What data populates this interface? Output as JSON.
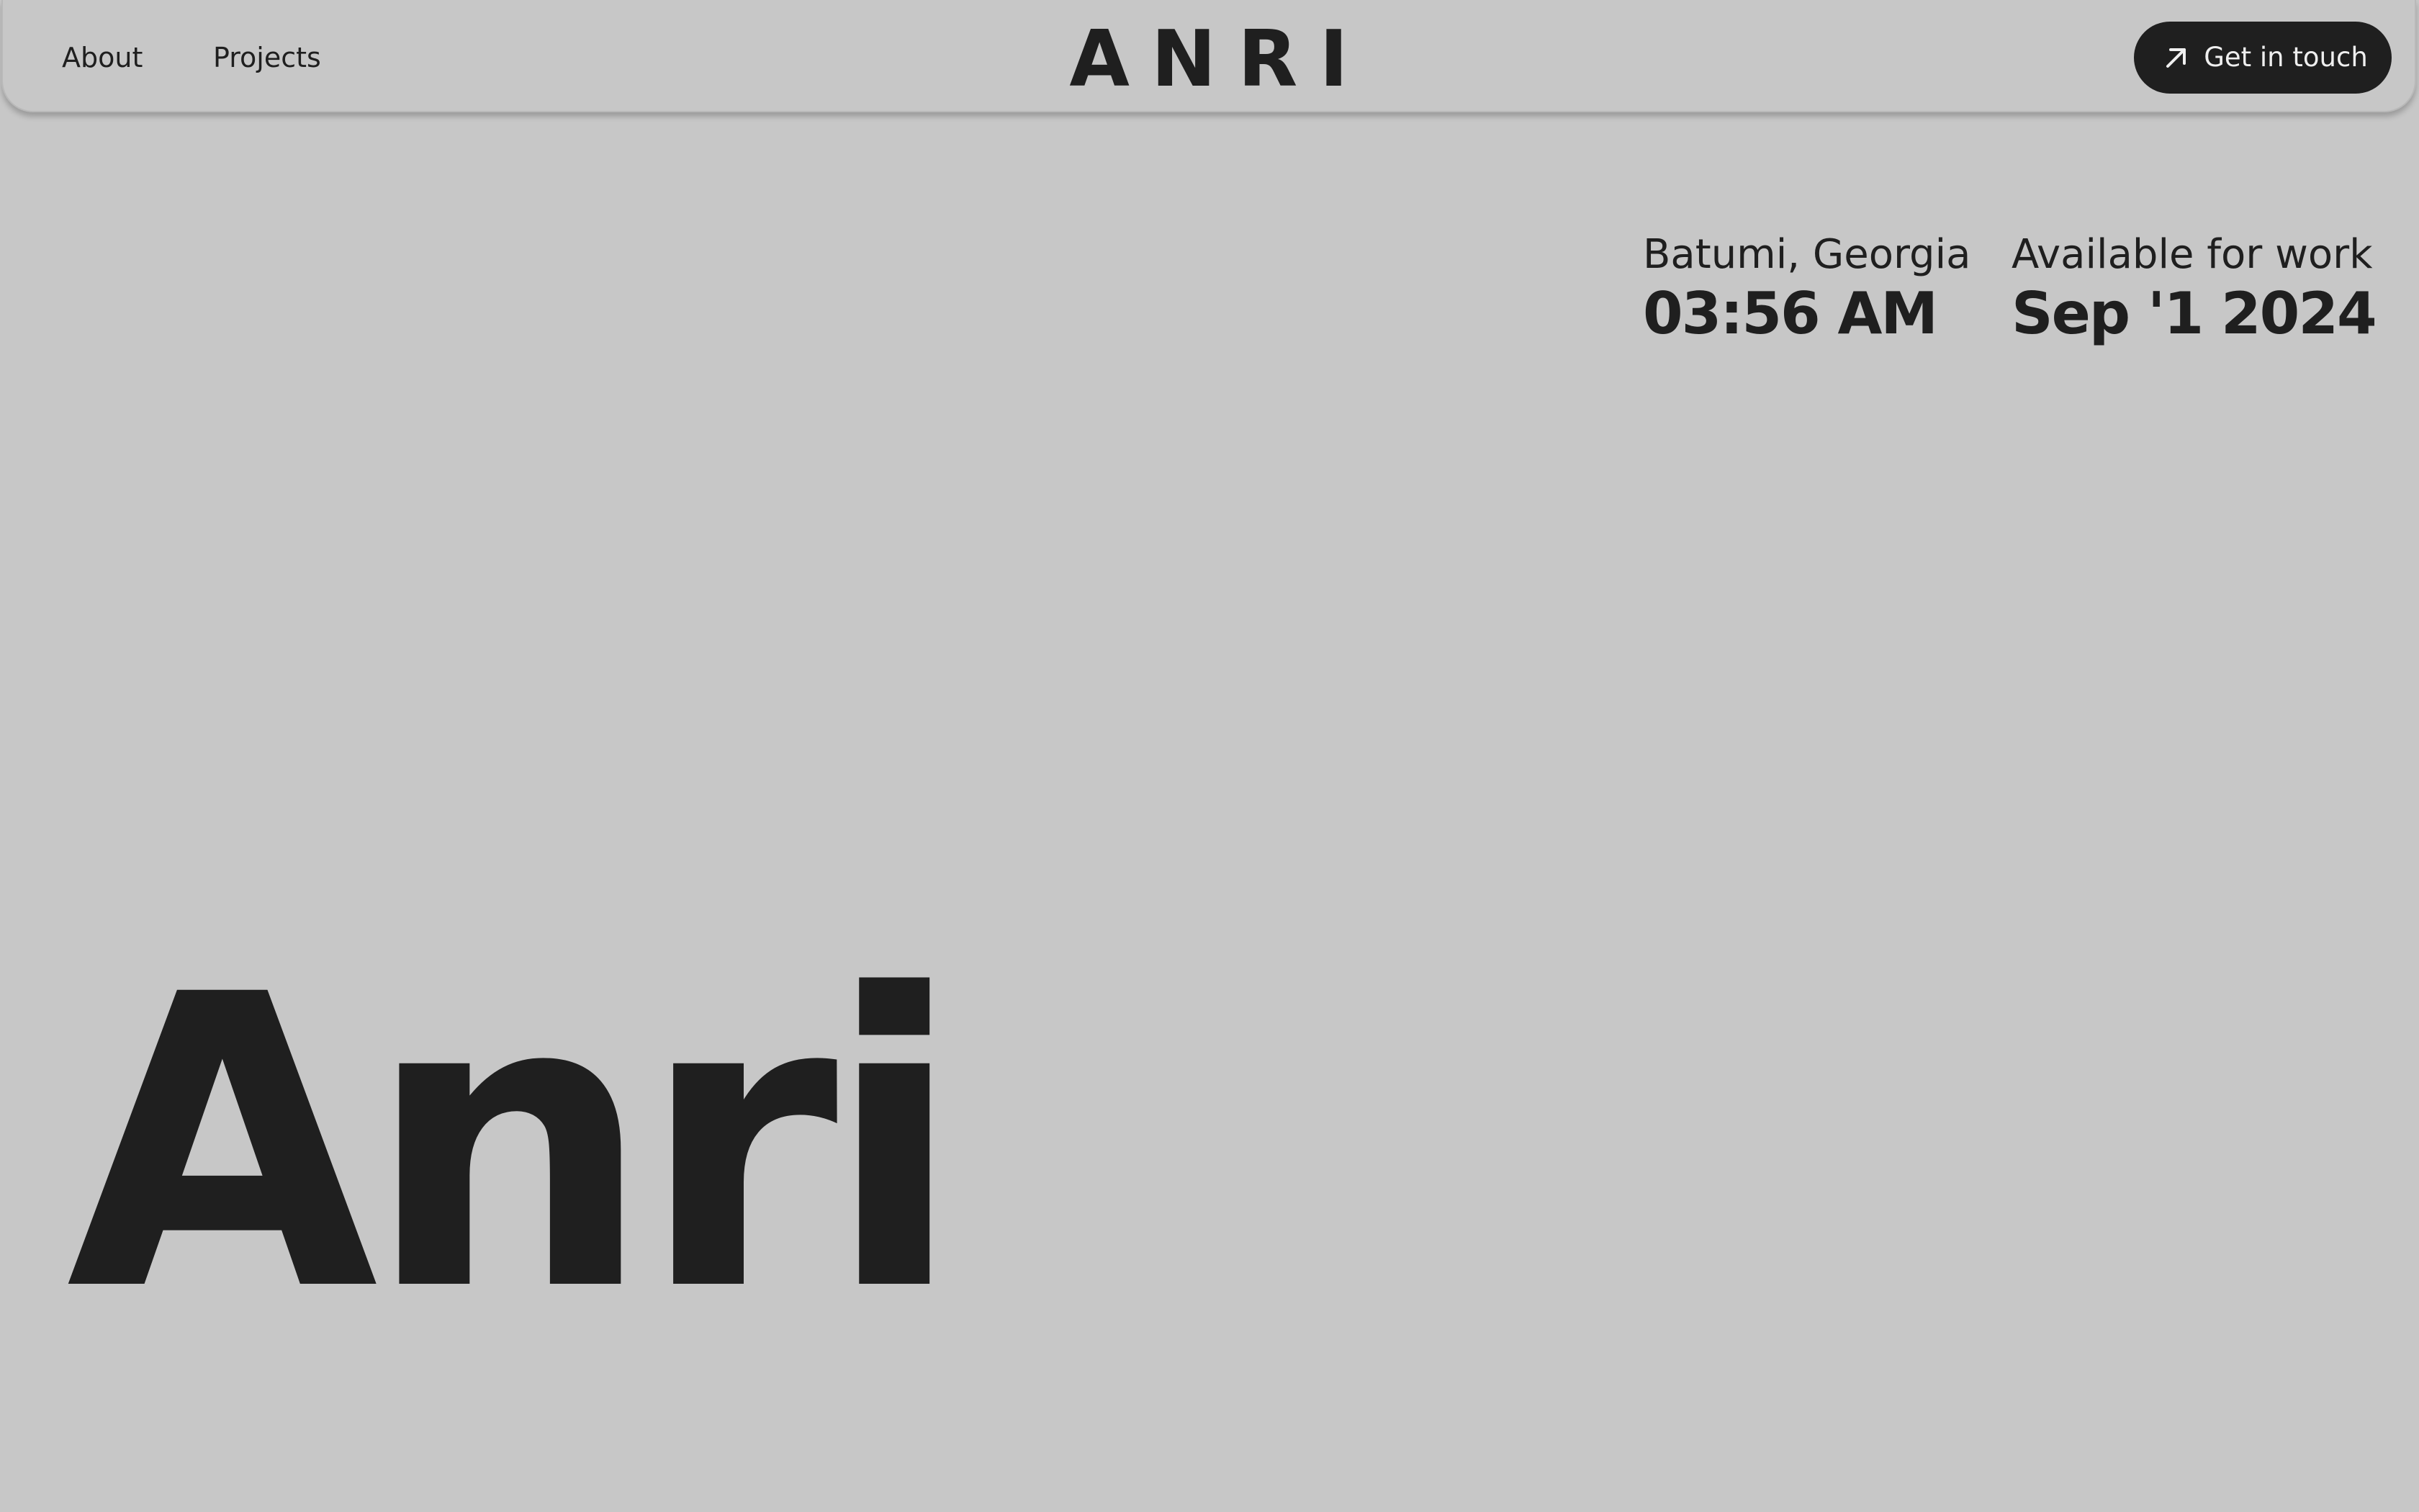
{
  "nav": {
    "about_label": "About",
    "projects_label": "Projects"
  },
  "header": {
    "logo": "ANRI",
    "cta_label": "Get in touch",
    "cta_icon": "arrow-up-right-icon"
  },
  "info": {
    "location_label": "Batumi, Georgia",
    "location_time": "03:56 AM",
    "availability_label": "Available for work",
    "availability_date": "Sep '1 2024"
  },
  "hero": {
    "title": "Anri"
  },
  "colors": {
    "background": "#c7c7c7",
    "text": "#1f1f1f",
    "button_bg": "#1f1f1f",
    "button_text": "#efefef"
  }
}
